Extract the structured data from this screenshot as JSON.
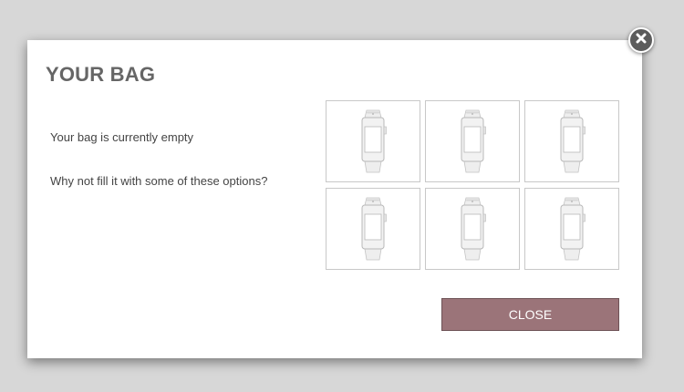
{
  "dialog": {
    "title": "YOUR BAG",
    "empty_message": "Your bag is currently empty",
    "suggestion_message": "Why not fill it with some of these options?",
    "close_button_label": "CLOSE",
    "close_icon": "close-icon"
  },
  "products": [
    {
      "icon": "watch-icon"
    },
    {
      "icon": "watch-icon"
    },
    {
      "icon": "watch-icon"
    },
    {
      "icon": "watch-icon"
    },
    {
      "icon": "watch-icon"
    },
    {
      "icon": "watch-icon"
    }
  ],
  "colors": {
    "accent": "#9b7479",
    "title": "#666666",
    "overlay": "#d7d7d7"
  }
}
